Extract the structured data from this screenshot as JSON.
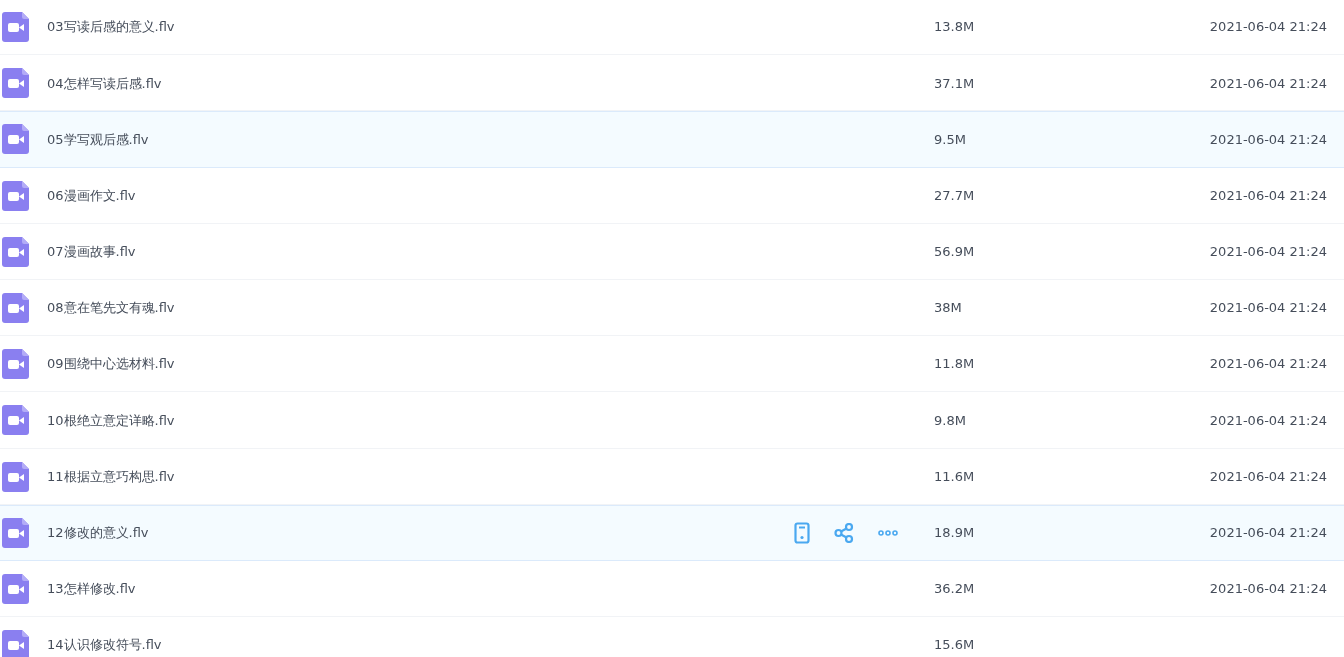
{
  "files": [
    {
      "name": "03写读后感的意义.flv",
      "size": "13.8M",
      "date": "2021-06-04 21:24",
      "highlighted": false,
      "hovered": false
    },
    {
      "name": "04怎样写读后感.flv",
      "size": "37.1M",
      "date": "2021-06-04 21:24",
      "highlighted": false,
      "hovered": false
    },
    {
      "name": "05学写观后感.flv",
      "size": "9.5M",
      "date": "2021-06-04 21:24",
      "highlighted": true,
      "hovered": false
    },
    {
      "name": "06漫画作文.flv",
      "size": "27.7M",
      "date": "2021-06-04 21:24",
      "highlighted": false,
      "hovered": false
    },
    {
      "name": "07漫画故事.flv",
      "size": "56.9M",
      "date": "2021-06-04 21:24",
      "highlighted": false,
      "hovered": false
    },
    {
      "name": "08意在笔先文有魂.flv",
      "size": "38M",
      "date": "2021-06-04 21:24",
      "highlighted": false,
      "hovered": false
    },
    {
      "name": "09围绕中心选材料.flv",
      "size": "11.8M",
      "date": "2021-06-04 21:24",
      "highlighted": false,
      "hovered": false
    },
    {
      "name": "10根绝立意定详略.flv",
      "size": "9.8M",
      "date": "2021-06-04 21:24",
      "highlighted": false,
      "hovered": false
    },
    {
      "name": "11根据立意巧构思.flv",
      "size": "11.6M",
      "date": "2021-06-04 21:24",
      "highlighted": false,
      "hovered": false
    },
    {
      "name": "12修改的意义.flv",
      "size": "18.9M",
      "date": "2021-06-04 21:24",
      "highlighted": true,
      "hovered": true
    },
    {
      "name": "13怎样修改.flv",
      "size": "36.2M",
      "date": "2021-06-04 21:24",
      "highlighted": false,
      "hovered": false
    },
    {
      "name": "14认识修改符号.flv",
      "size": "15.6M",
      "highlighted": false,
      "hovered": false
    }
  ]
}
